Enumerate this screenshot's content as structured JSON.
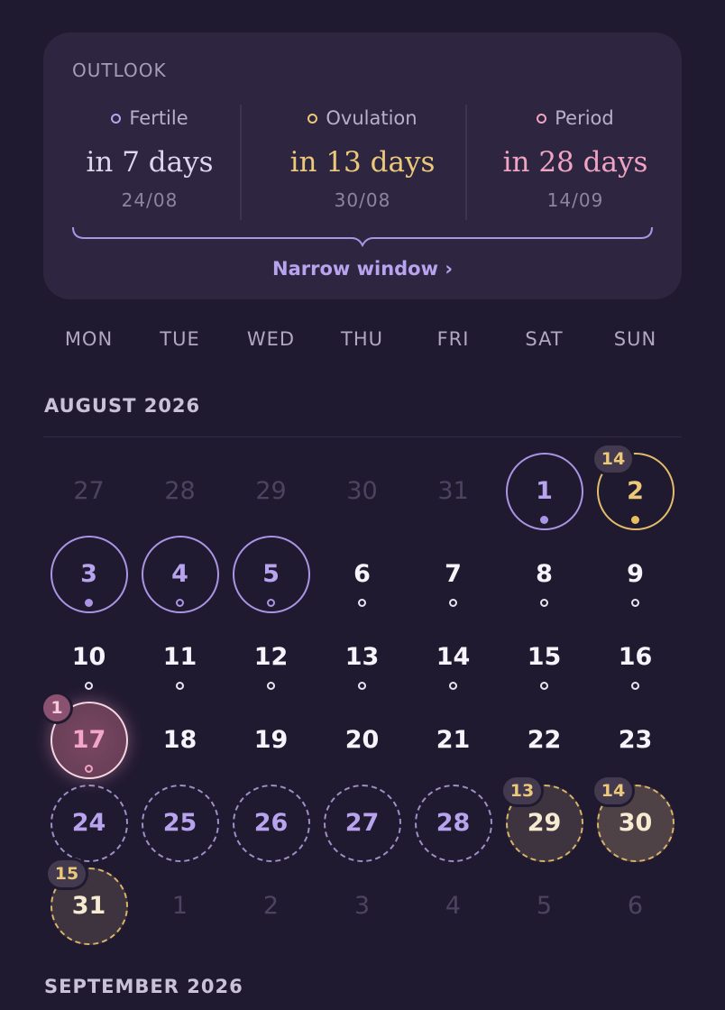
{
  "outlook": {
    "title": "OUTLOOK",
    "columns": [
      {
        "label": "Fertile",
        "main": "in 7 days",
        "date": "24/08",
        "color": "#b8a4ee"
      },
      {
        "label": "Ovulation",
        "main": "in 13 days",
        "date": "30/08",
        "color": "#ecc879"
      },
      {
        "label": "Period",
        "main": "in 28 days",
        "date": "14/09",
        "color": "#f0a3c3"
      }
    ],
    "link": "Narrow window ›"
  },
  "weekdays": [
    "MON",
    "TUE",
    "WED",
    "THU",
    "FRI",
    "SAT",
    "SUN"
  ],
  "months": [
    {
      "label": "AUGUST 2026",
      "weeks": [
        [
          {
            "n": "27",
            "kind": "faded"
          },
          {
            "n": "28",
            "kind": "faded"
          },
          {
            "n": "29",
            "kind": "faded"
          },
          {
            "n": "30",
            "kind": "faded"
          },
          {
            "n": "31",
            "kind": "faded"
          },
          {
            "n": "1",
            "kind": "period-solid",
            "dot": "filled-purple"
          },
          {
            "n": "2",
            "kind": "gold-ring",
            "dot": "filled-gold",
            "badge": "14"
          }
        ],
        [
          {
            "n": "3",
            "kind": "period-solid",
            "dot": "filled-purple"
          },
          {
            "n": "4",
            "kind": "period-solid",
            "dot": "hollow-purple"
          },
          {
            "n": "5",
            "kind": "period-solid",
            "dot": "hollow-purple"
          },
          {
            "n": "6",
            "kind": "normal",
            "dot": "hollow-white"
          },
          {
            "n": "7",
            "kind": "normal",
            "dot": "hollow-white"
          },
          {
            "n": "8",
            "kind": "normal",
            "dot": "hollow-white"
          },
          {
            "n": "9",
            "kind": "normal",
            "dot": "hollow-white"
          }
        ],
        [
          {
            "n": "10",
            "kind": "normal",
            "dot": "hollow-white"
          },
          {
            "n": "11",
            "kind": "normal",
            "dot": "hollow-white"
          },
          {
            "n": "12",
            "kind": "normal",
            "dot": "hollow-white"
          },
          {
            "n": "13",
            "kind": "normal",
            "dot": "hollow-white"
          },
          {
            "n": "14",
            "kind": "normal",
            "dot": "hollow-white"
          },
          {
            "n": "15",
            "kind": "normal",
            "dot": "hollow-white"
          },
          {
            "n": "16",
            "kind": "normal",
            "dot": "hollow-white"
          }
        ],
        [
          {
            "n": "17",
            "kind": "today",
            "dot": "hollow-pink",
            "badge": "1"
          },
          {
            "n": "18",
            "kind": "normal"
          },
          {
            "n": "19",
            "kind": "normal"
          },
          {
            "n": "20",
            "kind": "normal"
          },
          {
            "n": "21",
            "kind": "normal"
          },
          {
            "n": "22",
            "kind": "normal"
          },
          {
            "n": "23",
            "kind": "normal"
          }
        ],
        [
          {
            "n": "24",
            "kind": "fertile-dashed"
          },
          {
            "n": "25",
            "kind": "fertile-dashed"
          },
          {
            "n": "26",
            "kind": "fertile-dashed"
          },
          {
            "n": "27",
            "kind": "fertile-dashed"
          },
          {
            "n": "28",
            "kind": "fertile-dashed"
          },
          {
            "n": "29",
            "kind": "gold-dashed",
            "badge": "13"
          },
          {
            "n": "30",
            "kind": "gold-dashed-strong",
            "badge": "14"
          }
        ],
        [
          {
            "n": "31",
            "kind": "gold-dashed",
            "badge": "15"
          },
          {
            "n": "1",
            "kind": "faded"
          },
          {
            "n": "2",
            "kind": "faded"
          },
          {
            "n": "3",
            "kind": "faded"
          },
          {
            "n": "4",
            "kind": "faded"
          },
          {
            "n": "5",
            "kind": "faded"
          },
          {
            "n": "6",
            "kind": "faded"
          }
        ]
      ]
    },
    {
      "label": "SEPTEMBER 2026",
      "weeks": []
    }
  ]
}
